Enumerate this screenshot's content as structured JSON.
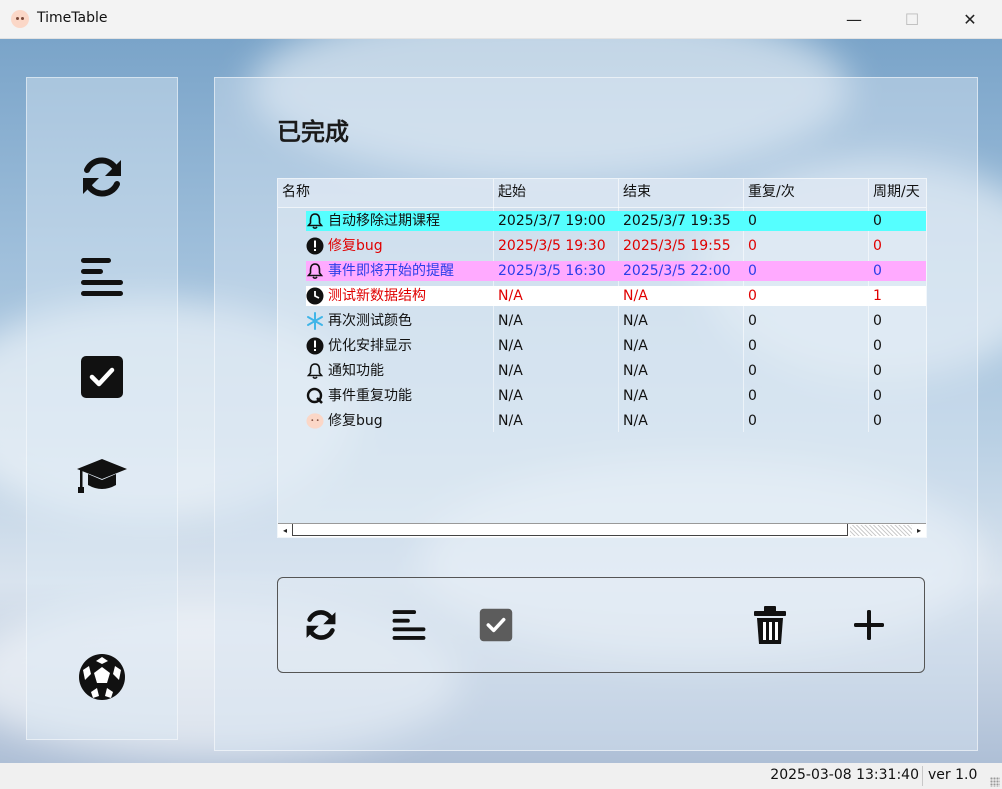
{
  "window": {
    "title": "TimeTable",
    "minimize": "—",
    "maximize": "☐",
    "close": "✕"
  },
  "sidebar": {
    "items": [
      {
        "name": "refresh",
        "icon": "refresh-icon"
      },
      {
        "name": "list",
        "icon": "list-icon"
      },
      {
        "name": "completed",
        "icon": "checkbox-icon"
      },
      {
        "name": "courses",
        "icon": "graduation-cap-icon"
      },
      {
        "name": "settings",
        "icon": "soccer-ball-icon"
      }
    ]
  },
  "main": {
    "title": "已完成",
    "table": {
      "columns": [
        "名称",
        "起始",
        "结束",
        "重复/次",
        "周期/天"
      ],
      "rows": [
        {
          "icon": "bell-icon",
          "name": "自动移除过期课程",
          "start": "2025/3/7 19:00",
          "end": "2025/3/7 19:35",
          "repeat": "0",
          "period": "0",
          "bg": "#55ffff",
          "color": "#111111"
        },
        {
          "icon": "alert-icon",
          "name": "修复bug",
          "start": "2025/3/5 19:30",
          "end": "2025/3/5 19:55",
          "repeat": "0",
          "period": "0",
          "bg": "",
          "color": "#e00000"
        },
        {
          "icon": "bell-icon",
          "name": "事件即将开始的提醒",
          "start": "2025/3/5 16:30",
          "end": "2025/3/5 22:00",
          "repeat": "0",
          "period": "0",
          "bg": "#ffaaff",
          "color": "#2a3ee8"
        },
        {
          "icon": "clock-icon",
          "name": "测试新数据结构",
          "start": "N/A",
          "end": "N/A",
          "repeat": "0",
          "period": "1",
          "bg": "#ffffff",
          "color": "#e00000"
        },
        {
          "icon": "snowflake-icon",
          "name": "再次测试颜色",
          "start": "N/A",
          "end": "N/A",
          "repeat": "0",
          "period": "0",
          "bg": "",
          "color": "#111111"
        },
        {
          "icon": "alert-icon",
          "name": "优化安排显示",
          "start": "N/A",
          "end": "N/A",
          "repeat": "0",
          "period": "0",
          "bg": "",
          "color": "#111111"
        },
        {
          "icon": "bell-icon",
          "name": "通知功能",
          "start": "N/A",
          "end": "N/A",
          "repeat": "0",
          "period": "0",
          "bg": "",
          "color": "#111111"
        },
        {
          "icon": "q-icon",
          "name": "事件重复功能",
          "start": "N/A",
          "end": "N/A",
          "repeat": "0",
          "period": "0",
          "bg": "",
          "color": "#111111"
        },
        {
          "icon": "pig-face-icon",
          "name": "修复bug",
          "start": "N/A",
          "end": "N/A",
          "repeat": "0",
          "period": "0",
          "bg": "",
          "color": "#111111"
        }
      ]
    },
    "toolbar": {
      "buttons": [
        {
          "name": "refresh",
          "icon": "refresh-icon"
        },
        {
          "name": "list",
          "icon": "list-icon"
        },
        {
          "name": "completed",
          "icon": "checkbox-icon"
        },
        {
          "name": "delete",
          "icon": "trash-icon"
        },
        {
          "name": "add",
          "icon": "plus-icon"
        }
      ]
    }
  },
  "status": {
    "datetime": "2025-03-08 13:31:40",
    "version": "ver 1.0"
  }
}
